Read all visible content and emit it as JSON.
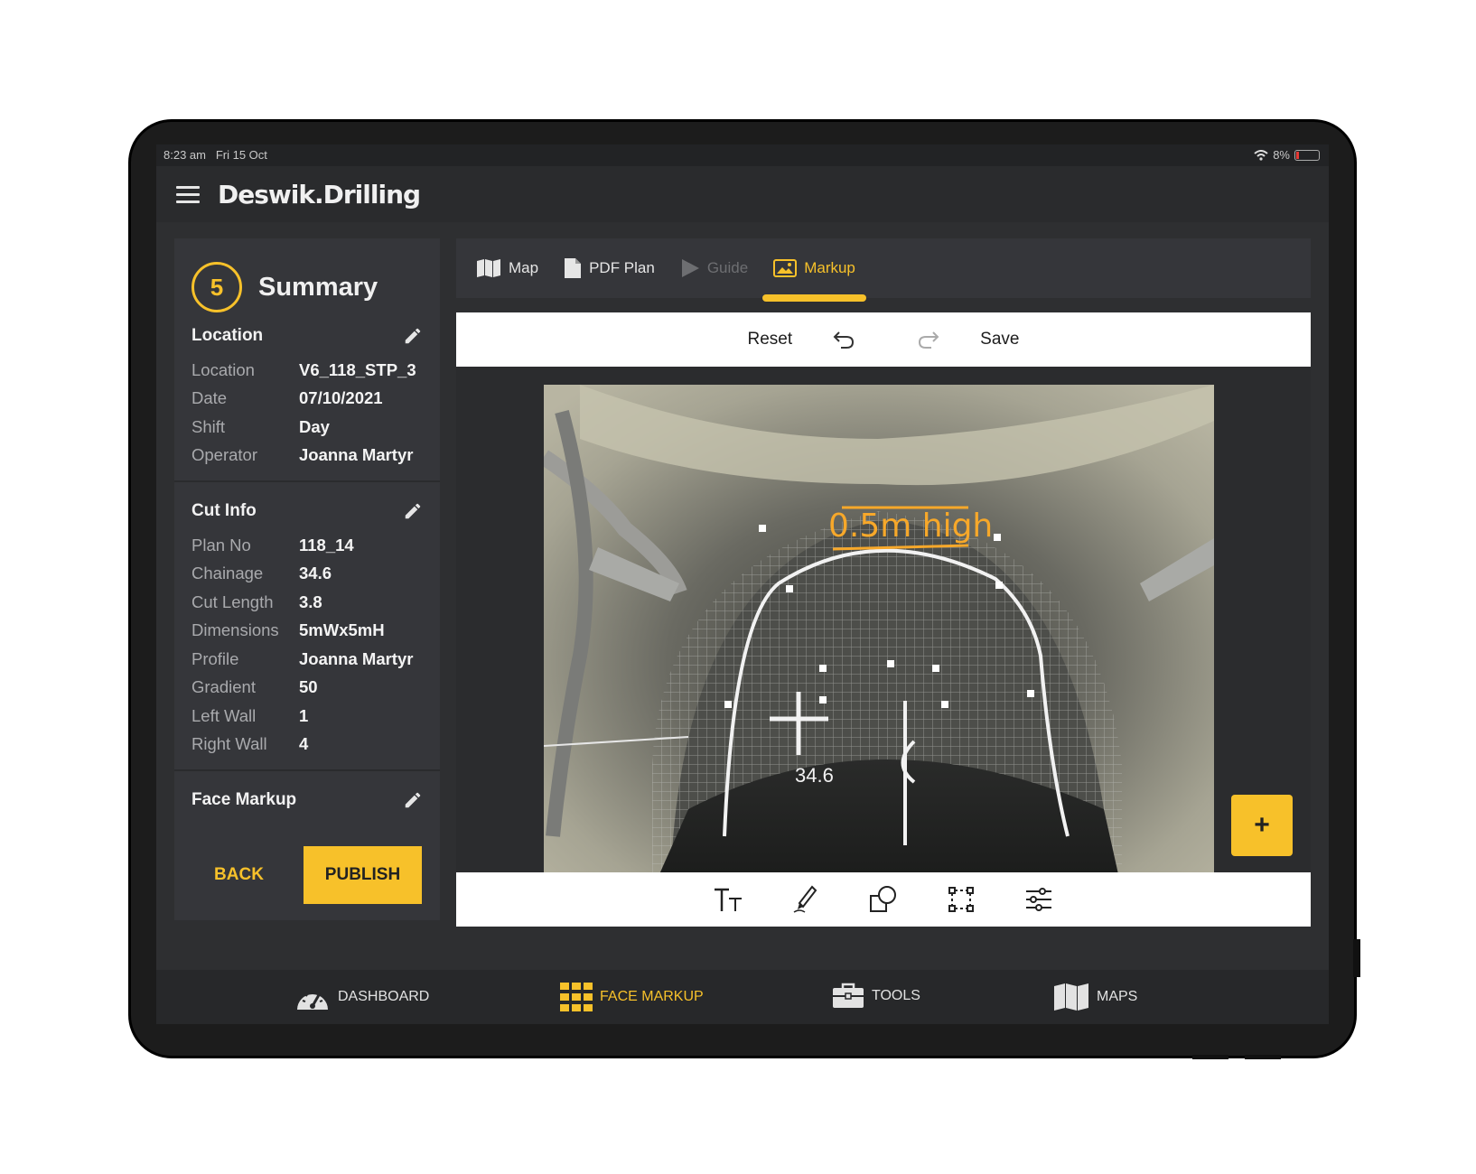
{
  "status": {
    "time": "8:23 am",
    "date": "Fri 15 Oct",
    "battery": "8%"
  },
  "app": {
    "title": "Deswik.Drilling"
  },
  "summary": {
    "step": "5",
    "title": "Summary",
    "location_section": {
      "title": "Location",
      "rows": [
        {
          "k": "Location",
          "v": "V6_118_STP_3"
        },
        {
          "k": "Date",
          "v": "07/10/2021"
        },
        {
          "k": "Shift",
          "v": "Day"
        },
        {
          "k": "Operator",
          "v": "Joanna Martyr"
        }
      ]
    },
    "cut_section": {
      "title": "Cut Info",
      "rows": [
        {
          "k": "Plan No",
          "v": "118_14"
        },
        {
          "k": "Chainage",
          "v": "34.6"
        },
        {
          "k": "Cut Length",
          "v": "3.8"
        },
        {
          "k": "Dimensions",
          "v": "5mWx5mH"
        },
        {
          "k": "Profile",
          "v": "Joanna Martyr"
        },
        {
          "k": "Gradient",
          "v": "50"
        },
        {
          "k": "Left Wall",
          "v": "1"
        },
        {
          "k": "Right Wall",
          "v": "4"
        }
      ]
    },
    "face_section": {
      "title": "Face Markup"
    },
    "back_label": "BACK",
    "publish_label": "PUBLISH"
  },
  "tabs": [
    {
      "label": "Map",
      "icon": "map-icon",
      "state": "normal"
    },
    {
      "label": "PDF Plan",
      "icon": "document-icon",
      "state": "normal"
    },
    {
      "label": "Guide",
      "icon": "play-icon",
      "state": "disabled"
    },
    {
      "label": "Markup",
      "icon": "image-icon",
      "state": "active"
    }
  ],
  "editor": {
    "reset_label": "Reset",
    "save_label": "Save",
    "annotation_text": "0.5m high",
    "chainage_mark": "34.6",
    "fab_label": "+",
    "tools": [
      "text-tool-icon",
      "pen-tool-icon",
      "shape-tool-icon",
      "select-tool-icon",
      "adjust-tool-icon"
    ]
  },
  "nav": [
    {
      "label": "DASHBOARD",
      "icon": "gauge-icon",
      "active": false
    },
    {
      "label": "FACE MARKUP",
      "icon": "grid-icon",
      "active": true
    },
    {
      "label": "TOOLS",
      "icon": "toolbox-icon",
      "active": false
    },
    {
      "label": "MAPS",
      "icon": "map-icon",
      "active": false
    }
  ],
  "colors": {
    "accent": "#f7c12a",
    "panel": "#35363a",
    "background": "#2e2f31"
  }
}
